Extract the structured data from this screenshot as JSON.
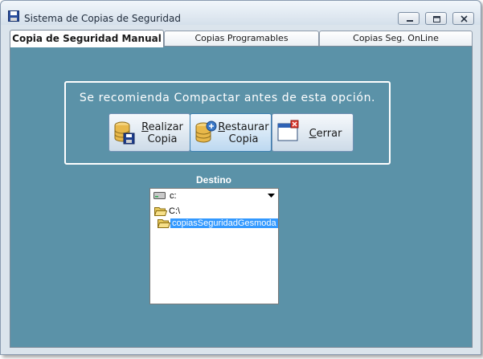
{
  "window": {
    "title": "Sistema de Copias de Seguridad",
    "controls": [
      "minimize-icon",
      "maximize-icon",
      "close-icon"
    ]
  },
  "tabs": [
    {
      "label": "Copia de Seguridad Manual",
      "active": true
    },
    {
      "label": "Copias Programables",
      "active": false
    },
    {
      "label": "Copias Seg. OnLine",
      "active": false
    }
  ],
  "panel": {
    "background": "#5b92a8",
    "recommendation": "Se recomienda Compactar antes de esta opción.",
    "buttons": {
      "realizar": {
        "hotkey": "R",
        "line1_rest": "ealizar",
        "line2": "Copia",
        "icon": "database-save-icon"
      },
      "restaurar": {
        "hotkey": "R",
        "line1_rest": "estaurar",
        "line2": "Copia",
        "icon": "database-restore-icon"
      },
      "cerrar": {
        "hotkey": "C",
        "rest": "errar",
        "icon": "window-close-icon"
      }
    },
    "destino": {
      "label": "Destino",
      "drive": "c:",
      "folders": [
        {
          "name": "C:\\",
          "open": true,
          "selected": false
        },
        {
          "name": "copiasSeguridadGesmoda",
          "open": true,
          "selected": true
        }
      ]
    }
  }
}
